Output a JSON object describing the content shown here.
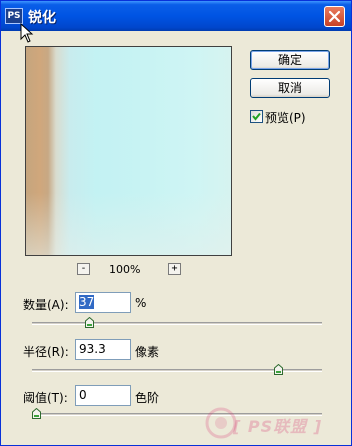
{
  "window": {
    "title": "锐化",
    "icon_label": "PS",
    "icons": {
      "close": "close-icon",
      "cursor": "cursor-arrow-icon",
      "app": "photoshop-icon"
    },
    "colors": {
      "titlebar": "#0054e3",
      "close": "#e05a3a",
      "dialog_bg": "#ece9d8",
      "selection": "#316ac5"
    }
  },
  "buttons": {
    "ok_label": "确定",
    "cancel_label": "取消"
  },
  "preview_option": {
    "label": "预览(P)",
    "checked": true
  },
  "zoom": {
    "minus_label": "-",
    "plus_label": "+",
    "level": "100%"
  },
  "amount": {
    "label": "数量(A):",
    "value": "37",
    "unit": "%",
    "slider_fraction": 0.19
  },
  "radius": {
    "label": "半径(R):",
    "value": "93.3",
    "unit": "像素",
    "slider_fraction": 0.86
  },
  "threshold": {
    "label": "阈值(T):",
    "value": "0",
    "unit": "色阶",
    "slider_fraction": 0.0
  },
  "watermark": {
    "text": "[ PS联盟 ]"
  }
}
